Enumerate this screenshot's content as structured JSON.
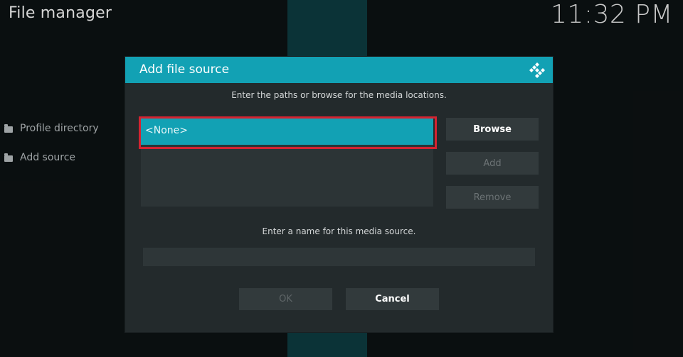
{
  "app": {
    "title": "File manager",
    "clock": "11:32 PM"
  },
  "sidebar": {
    "items": [
      {
        "label": "Profile directory",
        "icon": "folder-icon"
      },
      {
        "label": "Add source",
        "icon": "folder-icon"
      }
    ]
  },
  "dialog": {
    "title": "Add file source",
    "logo_icon": "kodi-logo-icon",
    "paths_instruction": "Enter the paths or browse for the media locations.",
    "paths": [
      "<None>"
    ],
    "buttons": {
      "browse": "Browse",
      "add": "Add",
      "remove": "Remove",
      "ok": "OK",
      "cancel": "Cancel"
    },
    "name_instruction": "Enter a name for this media source.",
    "name_value": ""
  },
  "colors": {
    "accent": "#12a1b4",
    "highlight_border": "#d42331",
    "dialog_bg": "#232a2c",
    "background": "#0d1112"
  }
}
